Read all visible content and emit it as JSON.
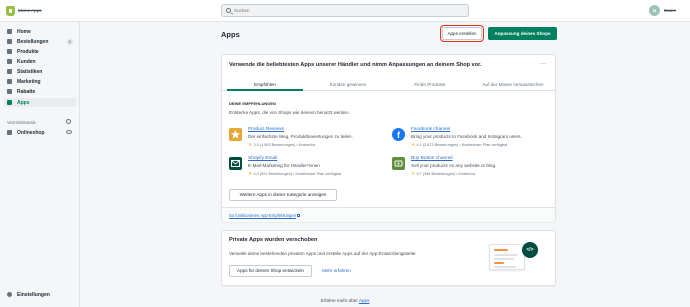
{
  "topbar": {
    "store_name": "Meine Apps",
    "search_placeholder": "Suchen",
    "avatar_initials": "M",
    "user_name": "Daten"
  },
  "sidebar": {
    "items": [
      {
        "label": "Home"
      },
      {
        "label": "Bestellungen",
        "badge": "1"
      },
      {
        "label": "Produkte"
      },
      {
        "label": "Kunden"
      },
      {
        "label": "Statistiken"
      },
      {
        "label": "Marketing"
      },
      {
        "label": "Rabatte"
      },
      {
        "label": "Apps"
      }
    ],
    "channels_title": "Vertriebskanäle",
    "onlineshop_label": "Onlineshop",
    "settings_label": "Einstellungen"
  },
  "main": {
    "title": "Apps",
    "create_apps_label": "Apps erstellen",
    "customize_label": "Anpassung deines Shops"
  },
  "featured": {
    "title": "Verwende die beliebtesten Apps unserer Händler und nimm Anpassungen an deinem Shop vor.",
    "more_label": "···",
    "tabs": [
      "Empfohlen",
      "Kunden gewinnen",
      "Finde Produkte",
      "Auf der Masse herausstechen"
    ],
    "section_label": "DEINE EMPFEHLUNGEN",
    "section_desc": "Entdecke Apps, die von Shops wie deinem benutzt werden.",
    "apps": [
      {
        "name": "Product Reviews",
        "desc": "Der einfachste Weg, Produktbewertungen zu teilen.",
        "meta": "3.5 (1.553 Bewertungen) • Kostenlos"
      },
      {
        "name": "Facebook channel",
        "desc": "Bring your products to Facebook and Instagram users.",
        "meta": "4.1 (2.873 Bewertungen) • Kostenloser Plan verfügbar"
      },
      {
        "name": "Shopify Email",
        "desc": "E-Mail-Marketing für Händler*innen",
        "meta": "4.4 (901 Bewertungen) • Kostenloser Plan verfügbar"
      },
      {
        "name": "Buy Button channel",
        "desc": "Sell your products on any website or blog.",
        "meta": "3.7 (346 Bewertungen) • Kostenlos"
      }
    ],
    "more_apps_label": "Weitere Apps in dieser Kategorie anzeigen",
    "footer_link": "So funktionieren App-Empfehlungen"
  },
  "private": {
    "title": "Private Apps wurden verschoben",
    "desc": "Verwalte deine bestehenden privaten Apps und erstelle Apps auf der App-Entwicklungsseite.",
    "develop_label": "Apps für deinen Shop entwickeln",
    "learn_more": "Mehr erfahren",
    "code_symbol": "</>"
  },
  "bottom": {
    "text": "Erfahre mehr über",
    "link": "Apps"
  },
  "colors": {
    "accent": "#008060",
    "link": "#2c6ecb",
    "highlight": "#de3618"
  }
}
